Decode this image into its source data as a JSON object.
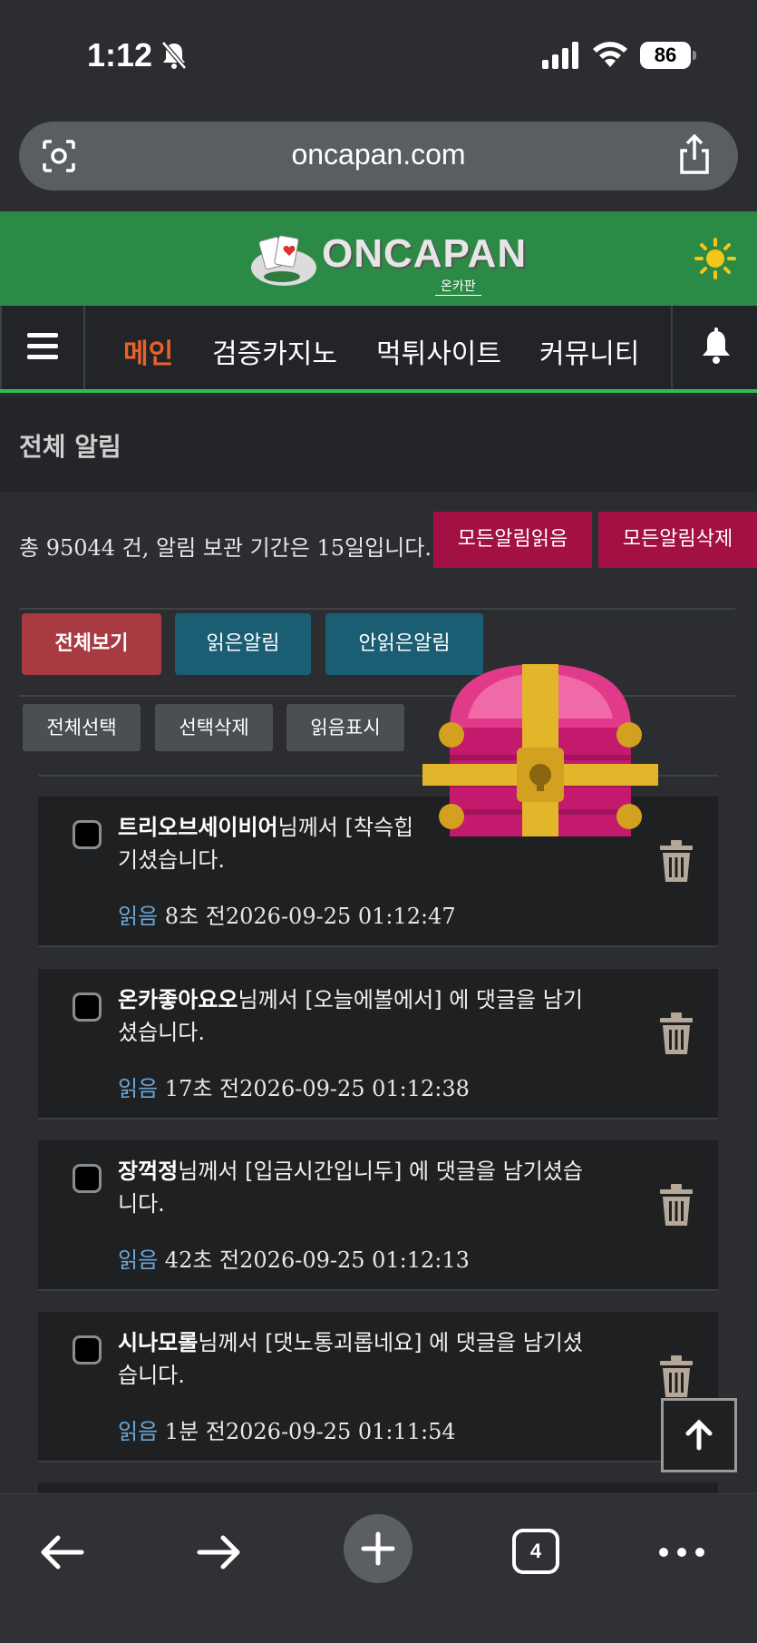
{
  "status_bar": {
    "time": "1:12",
    "battery": "86"
  },
  "browser": {
    "url": "oncapan.com",
    "tab_count": "4"
  },
  "site": {
    "logo_text": "ONCAPAN",
    "logo_sub": "온카판"
  },
  "nav": {
    "items": [
      "메인",
      "검증카지노",
      "먹튀사이트",
      "커뮤니티"
    ],
    "active_color": "#e8622b"
  },
  "page": {
    "title": "전체 알림",
    "summary": "총 95044 건, 알림 보관 기간은 15일입니다.",
    "mark_all_read": "모든알림읽음",
    "delete_all": "모든알림삭제"
  },
  "filters": {
    "all": "전체보기",
    "read": "읽은알림",
    "unread": "안읽은알림"
  },
  "tools": {
    "select_all": "전체선택",
    "delete_selected": "선택삭제",
    "mark_read": "읽음표시"
  },
  "notifications": [
    {
      "user": "트리오브세이비어",
      "text": "님께서 [착슥힙",
      "text2": "기셨습니다.",
      "read": "읽음",
      "ago": " 8초 전",
      "datetime": "2026-09-25 01:12:47"
    },
    {
      "user": "온카좋아요오",
      "text": "님께서 [오늘에볼에서] 에 댓글을 남기",
      "text2": "셨습니다.",
      "read": "읽음",
      "ago": " 17초 전",
      "datetime": "2026-09-25 01:12:38"
    },
    {
      "user": "장꺽정",
      "text": "님께서 [입금시간입니두] 에 댓글을 남기셨습",
      "text2": "니다.",
      "read": "읽음",
      "ago": " 42초 전",
      "datetime": "2026-09-25 01:12:13"
    },
    {
      "user": "시나모롤",
      "text": "님께서 [댓노통괴롭네요] 에 댓글을 남기셨",
      "text2": "습니다.",
      "read": "읽음",
      "ago": " 1분 전",
      "datetime": "2026-09-25 01:11:54"
    }
  ],
  "colors": {
    "header_green": "#2b8a45",
    "button_red": "#a21044",
    "filter_blue": "#1b5e74"
  }
}
